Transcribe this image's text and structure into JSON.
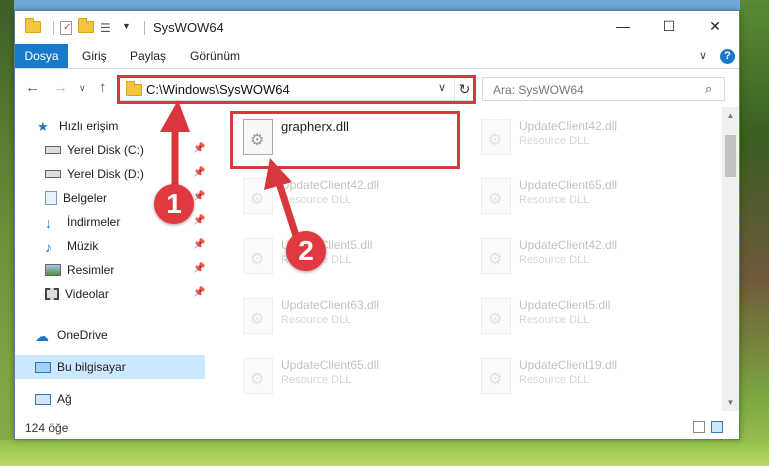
{
  "window": {
    "title": "SysWOW64",
    "minimize": "—",
    "maximize": "☐",
    "close": "✕"
  },
  "ribbon": {
    "tabs": [
      "Dosya",
      "Giriş",
      "Paylaş",
      "Görünüm"
    ],
    "help": "?"
  },
  "address": {
    "path": "C:\\Windows\\SysWOW64",
    "search_placeholder": "Ara: SysWOW64"
  },
  "sidebar": {
    "items": [
      {
        "label": "Hızlı erişim",
        "icon": "star-icon"
      },
      {
        "label": "Yerel Disk (C:)",
        "icon": "drive-icon"
      },
      {
        "label": "Yerel Disk (D:)",
        "icon": "drive-icon"
      },
      {
        "label": "Belgeler",
        "icon": "documents-icon"
      },
      {
        "label": "İndirmeler",
        "icon": "download-icon"
      },
      {
        "label": "Müzik",
        "icon": "music-icon"
      },
      {
        "label": "Resimler",
        "icon": "pictures-icon"
      },
      {
        "label": "Videolar",
        "icon": "videos-icon"
      },
      {
        "label": "OneDrive",
        "icon": "cloud-icon"
      },
      {
        "label": "Bu bilgisayar",
        "icon": "computer-icon"
      },
      {
        "label": "Ağ",
        "icon": "network-icon"
      }
    ]
  },
  "files": [
    {
      "name": "grapherx.dll",
      "type": ""
    },
    {
      "name": "UpdateClient42.dll",
      "type": "Resource DLL"
    },
    {
      "name": "UpdateClient42.dll",
      "type": "Resource DLL"
    },
    {
      "name": "UpdateClient65.dll",
      "type": "Resource DLL"
    },
    {
      "name": "UpdateClient5.dll",
      "type": "Resource DLL"
    },
    {
      "name": "UpdateClient42.dll",
      "type": "Resource DLL"
    },
    {
      "name": "UpdateClient63.dll",
      "type": "Resource DLL"
    },
    {
      "name": "UpdateClient5.dll",
      "type": "Resource DLL"
    },
    {
      "name": "UpdateClient65.dll",
      "type": "Resource DLL"
    },
    {
      "name": "UpdateClient19.dll",
      "type": "Resource DLL"
    }
  ],
  "status": {
    "count": "124 öğe"
  },
  "annotations": {
    "step1": "1",
    "step2": "2",
    "color": "#d9363e"
  }
}
